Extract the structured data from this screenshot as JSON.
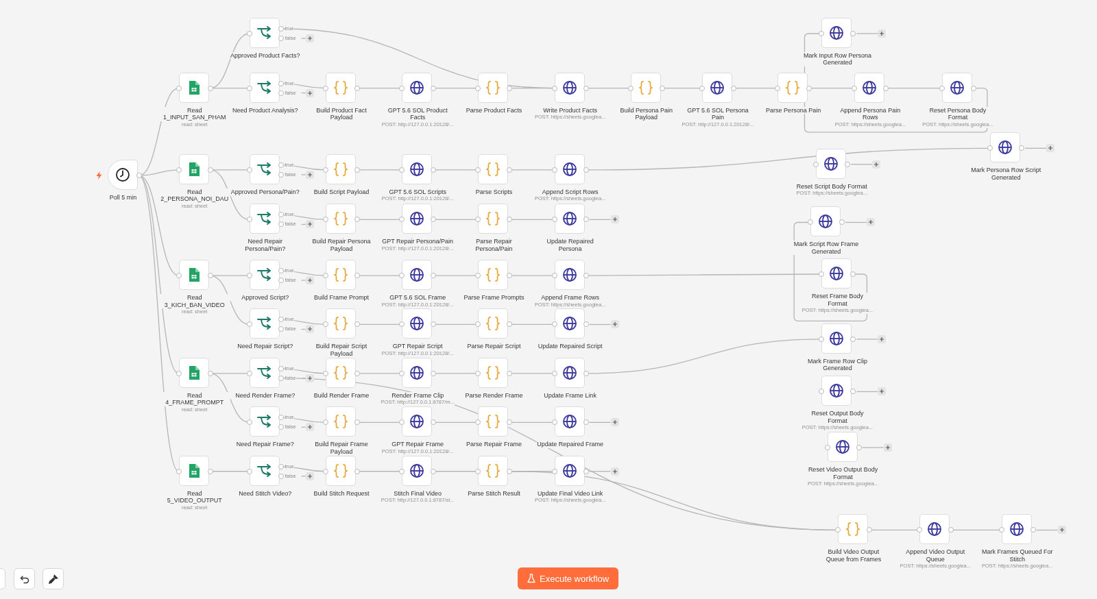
{
  "canvas": {
    "nodes": [
      {
        "kind": "trigger",
        "name": "Poll 5 min"
      },
      {
        "kind": "sheets",
        "name": "Read 1_INPUT_SAN_PHAM",
        "subtitle": "read: sheet"
      },
      {
        "kind": "sheets",
        "name": "Read 2_PERSONA_NOI_DAU",
        "subtitle": "read: sheet"
      },
      {
        "kind": "sheets",
        "name": "Read 3_KICH_BAN_VIDEO",
        "subtitle": "read: sheet"
      },
      {
        "kind": "sheets",
        "name": "Read 4_FRAME_PROMPT",
        "subtitle": "read: sheet"
      },
      {
        "kind": "sheets",
        "name": "Read 5_VIDEO_OUTPUT",
        "subtitle": "read: sheet"
      },
      {
        "kind": "if",
        "name": "Approved Product Facts?",
        "outputs": [
          "true",
          "false"
        ]
      },
      {
        "kind": "if",
        "name": "Need Product Analysis?",
        "outputs": [
          "true",
          "false"
        ]
      },
      {
        "kind": "if",
        "name": "Approved Persona/Pain?",
        "outputs": [
          "true",
          "false"
        ]
      },
      {
        "kind": "if",
        "name": "Need Repair Persona/Pain?",
        "outputs": [
          "true",
          "false"
        ]
      },
      {
        "kind": "if",
        "name": "Approved Script?",
        "outputs": [
          "true",
          "false"
        ]
      },
      {
        "kind": "if",
        "name": "Need Repair Script?",
        "outputs": [
          "true",
          "false"
        ]
      },
      {
        "kind": "if",
        "name": "Need Render Frame?",
        "outputs": [
          "true",
          "false"
        ]
      },
      {
        "kind": "if",
        "name": "Need Repair Frame?",
        "outputs": [
          "true",
          "false"
        ]
      },
      {
        "kind": "if",
        "name": "Need Stitch Video?",
        "outputs": [
          "true",
          "false"
        ]
      },
      {
        "kind": "code",
        "name": "Build Product Fact Payload"
      },
      {
        "kind": "code",
        "name": "Build Script Payload"
      },
      {
        "kind": "code",
        "name": "Build Repair Persona Payload"
      },
      {
        "kind": "code",
        "name": "Build Frame Prompt"
      },
      {
        "kind": "code",
        "name": "Build Repair Script Payload"
      },
      {
        "kind": "code",
        "name": "Build Render Frame"
      },
      {
        "kind": "code",
        "name": "Build Repair Frame Payload"
      },
      {
        "kind": "code",
        "name": "Build Stitch Request"
      },
      {
        "kind": "http",
        "name": "GPT 5.6 SOL Product Facts",
        "subtitle": "POST: http://127.0.0.1:20128/..."
      },
      {
        "kind": "http",
        "name": "GPT 5.6 SOL Scripts",
        "subtitle": "POST: http://127.0.0.1:20128/..."
      },
      {
        "kind": "http",
        "name": "GPT Repair Persona/Pain",
        "subtitle": "POST: http://127.0.0.1:20128/..."
      },
      {
        "kind": "http",
        "name": "GPT 5.6 SOL Frame",
        "subtitle": "POST: http://127.0.0.1:20128/..."
      },
      {
        "kind": "http",
        "name": "GPT Repair Script",
        "subtitle": "POST: http://127.0.0.1:20128/..."
      },
      {
        "kind": "http",
        "name": "Render Frame Clip",
        "subtitle": "POST: http://127.0.0.1:8787/m..."
      },
      {
        "kind": "http",
        "name": "GPT Repair Frame",
        "subtitle": "POST: http://127.0.0.1:20128/..."
      },
      {
        "kind": "http",
        "name": "Stitch Final Video",
        "subtitle": "POST: http://127.0.0.1:8787/st..."
      },
      {
        "kind": "code",
        "name": "Parse Product Facts"
      },
      {
        "kind": "code",
        "name": "Parse Scripts"
      },
      {
        "kind": "code",
        "name": "Parse Repair Persona/Pain"
      },
      {
        "kind": "code",
        "name": "Parse Frame Prompts"
      },
      {
        "kind": "code",
        "name": "Parse Repair Script"
      },
      {
        "kind": "code",
        "name": "Parse Render Frame"
      },
      {
        "kind": "code",
        "name": "Parse Repair Frame"
      },
      {
        "kind": "code",
        "name": "Parse Stitch Result"
      },
      {
        "kind": "http",
        "name": "Write Product Facts",
        "subtitle": "POST: https://sheets.googlea..."
      },
      {
        "kind": "http",
        "name": "Append Script Rows",
        "subtitle": "POST: https://sheets.googlea..."
      },
      {
        "kind": "http",
        "name": "Update Repaired Persona"
      },
      {
        "kind": "http",
        "name": "Append Frame Rows",
        "subtitle": "POST: https://sheets.googlea..."
      },
      {
        "kind": "http",
        "name": "Update Repaired Script"
      },
      {
        "kind": "http",
        "name": "Update Frame Link"
      },
      {
        "kind": "http",
        "name": "Update Repaired Frame"
      },
      {
        "kind": "http",
        "name": "Update Final Video Link",
        "subtitle": "POST: https://sheets.googlea..."
      },
      {
        "kind": "code",
        "name": "Build Persona Pain Payload"
      },
      {
        "kind": "http",
        "name": "GPT 5.6 SOL Persona Pain",
        "subtitle": "POST: http://127.0.0.1:20128/..."
      },
      {
        "kind": "code",
        "name": "Parse Persona Pain"
      },
      {
        "kind": "http",
        "name": "Mark Input Row Persona Generated"
      },
      {
        "kind": "http",
        "name": "Append Persona Pain Rows",
        "subtitle": "POST: https://sheets.googlea..."
      },
      {
        "kind": "http",
        "name": "Reset Persona Body Format",
        "subtitle": "POST: https://sheets.googlea..."
      },
      {
        "kind": "http",
        "name": "Mark Persona Row Script Generated"
      },
      {
        "kind": "http",
        "name": "Reset Script Body Format",
        "subtitle": "POST: https://sheets.googlea..."
      },
      {
        "kind": "http",
        "name": "Mark Script Row Frame Generated"
      },
      {
        "kind": "http",
        "name": "Reset Frame Body Format",
        "subtitle": "POST: https://sheets.googlea..."
      },
      {
        "kind": "http",
        "name": "Mark Frame Row Clip Generated"
      },
      {
        "kind": "http",
        "name": "Reset Output Body Format",
        "subtitle": "POST: https://sheets.googlea..."
      },
      {
        "kind": "http",
        "name": "Reset Video Output Body Format",
        "subtitle": "POST: https://sheets.googlea..."
      },
      {
        "kind": "code",
        "name": "Build Video Output Queue from Frames"
      },
      {
        "kind": "http",
        "name": "Append Video Output Queue",
        "subtitle": "POST: https://sheets.googlea..."
      },
      {
        "kind": "http",
        "name": "Mark Frames Queued For Stitch",
        "subtitle": "POST: https://sheets.googlea..."
      }
    ]
  },
  "execute_button": {
    "label": "Execute workflow"
  }
}
